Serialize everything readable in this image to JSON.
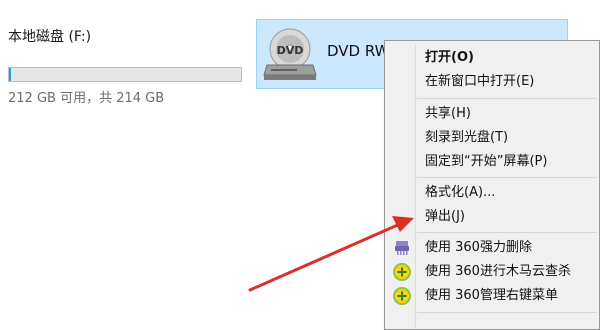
{
  "drives": {
    "f": {
      "name": "本地磁盘 (F:)",
      "size_text": "212 GB 可用，共 214 GB",
      "used_fraction": 0.01
    },
    "dvd": {
      "name": "DVD RW",
      "icon_text": "DVD"
    }
  },
  "context_menu": {
    "items": [
      {
        "label": "打开(O)",
        "bold": true
      },
      {
        "label": "在新窗口中打开(E)"
      },
      {
        "label": "共享(H)"
      },
      {
        "label": "刻录到光盘(T)"
      },
      {
        "label": "固定到“开始”屏幕(P)"
      },
      {
        "label": "格式化(A)..."
      },
      {
        "label": "弹出(J)"
      },
      {
        "label": "使用 360强力删除",
        "icon": "shredder-icon"
      },
      {
        "label": "使用 360进行木马云查杀",
        "icon": "plus-shield-icon"
      },
      {
        "label": "使用 360管理右键菜单",
        "icon": "plus-shield-icon"
      }
    ]
  },
  "colors": {
    "selection_bg": "#cce8ff",
    "progress_fill": "#26a0da",
    "arrow": "#d9302a",
    "shield_green": "#8cc63e",
    "shield_yellow": "#f7d117"
  }
}
